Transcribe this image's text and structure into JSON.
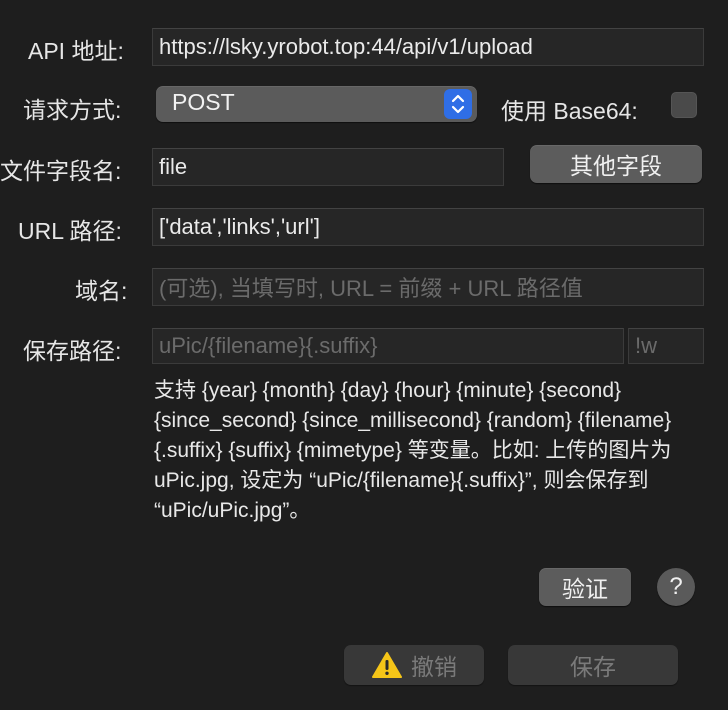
{
  "form": {
    "api_label": "API 地址:",
    "api_value": "https://lsky.yrobot.top:44/api/v1/upload",
    "method_label": "请求方式:",
    "method_value": "POST",
    "base64_label": "使用 Base64:",
    "file_field_label": "文件字段名:",
    "file_field_value": "file",
    "other_fields_button": "其他字段",
    "url_path_label": "URL 路径:",
    "url_path_value": "['data','links','url']",
    "domain_label": "域名:",
    "domain_placeholder": "(可选), 当填写时, URL = 前缀 + URL 路径值",
    "save_path_label": "保存路径:",
    "save_path_placeholder": "uPic/{filename}{.suffix}",
    "suffix_placeholder": "!w",
    "help_text": "支持 {year} {month} {day} {hour} {minute} {second} {since_second} {since_millisecond} {random} {filename} {.suffix} {suffix} {mimetype} 等变量。比如: 上传的图片为 uPic.jpg, 设定为 “uPic/{filename}{.suffix}”, 则会保存到 “uPic/uPic.jpg”。"
  },
  "actions": {
    "verify_button": "验证",
    "help_button": "?",
    "cancel_button": "撤销",
    "save_button": "保存"
  },
  "icons": {
    "warning": "warning-icon",
    "select_arrows": "chevron-up-down-icon",
    "accent_color": "#2f6ee6",
    "warning_color": "#f5c518"
  }
}
